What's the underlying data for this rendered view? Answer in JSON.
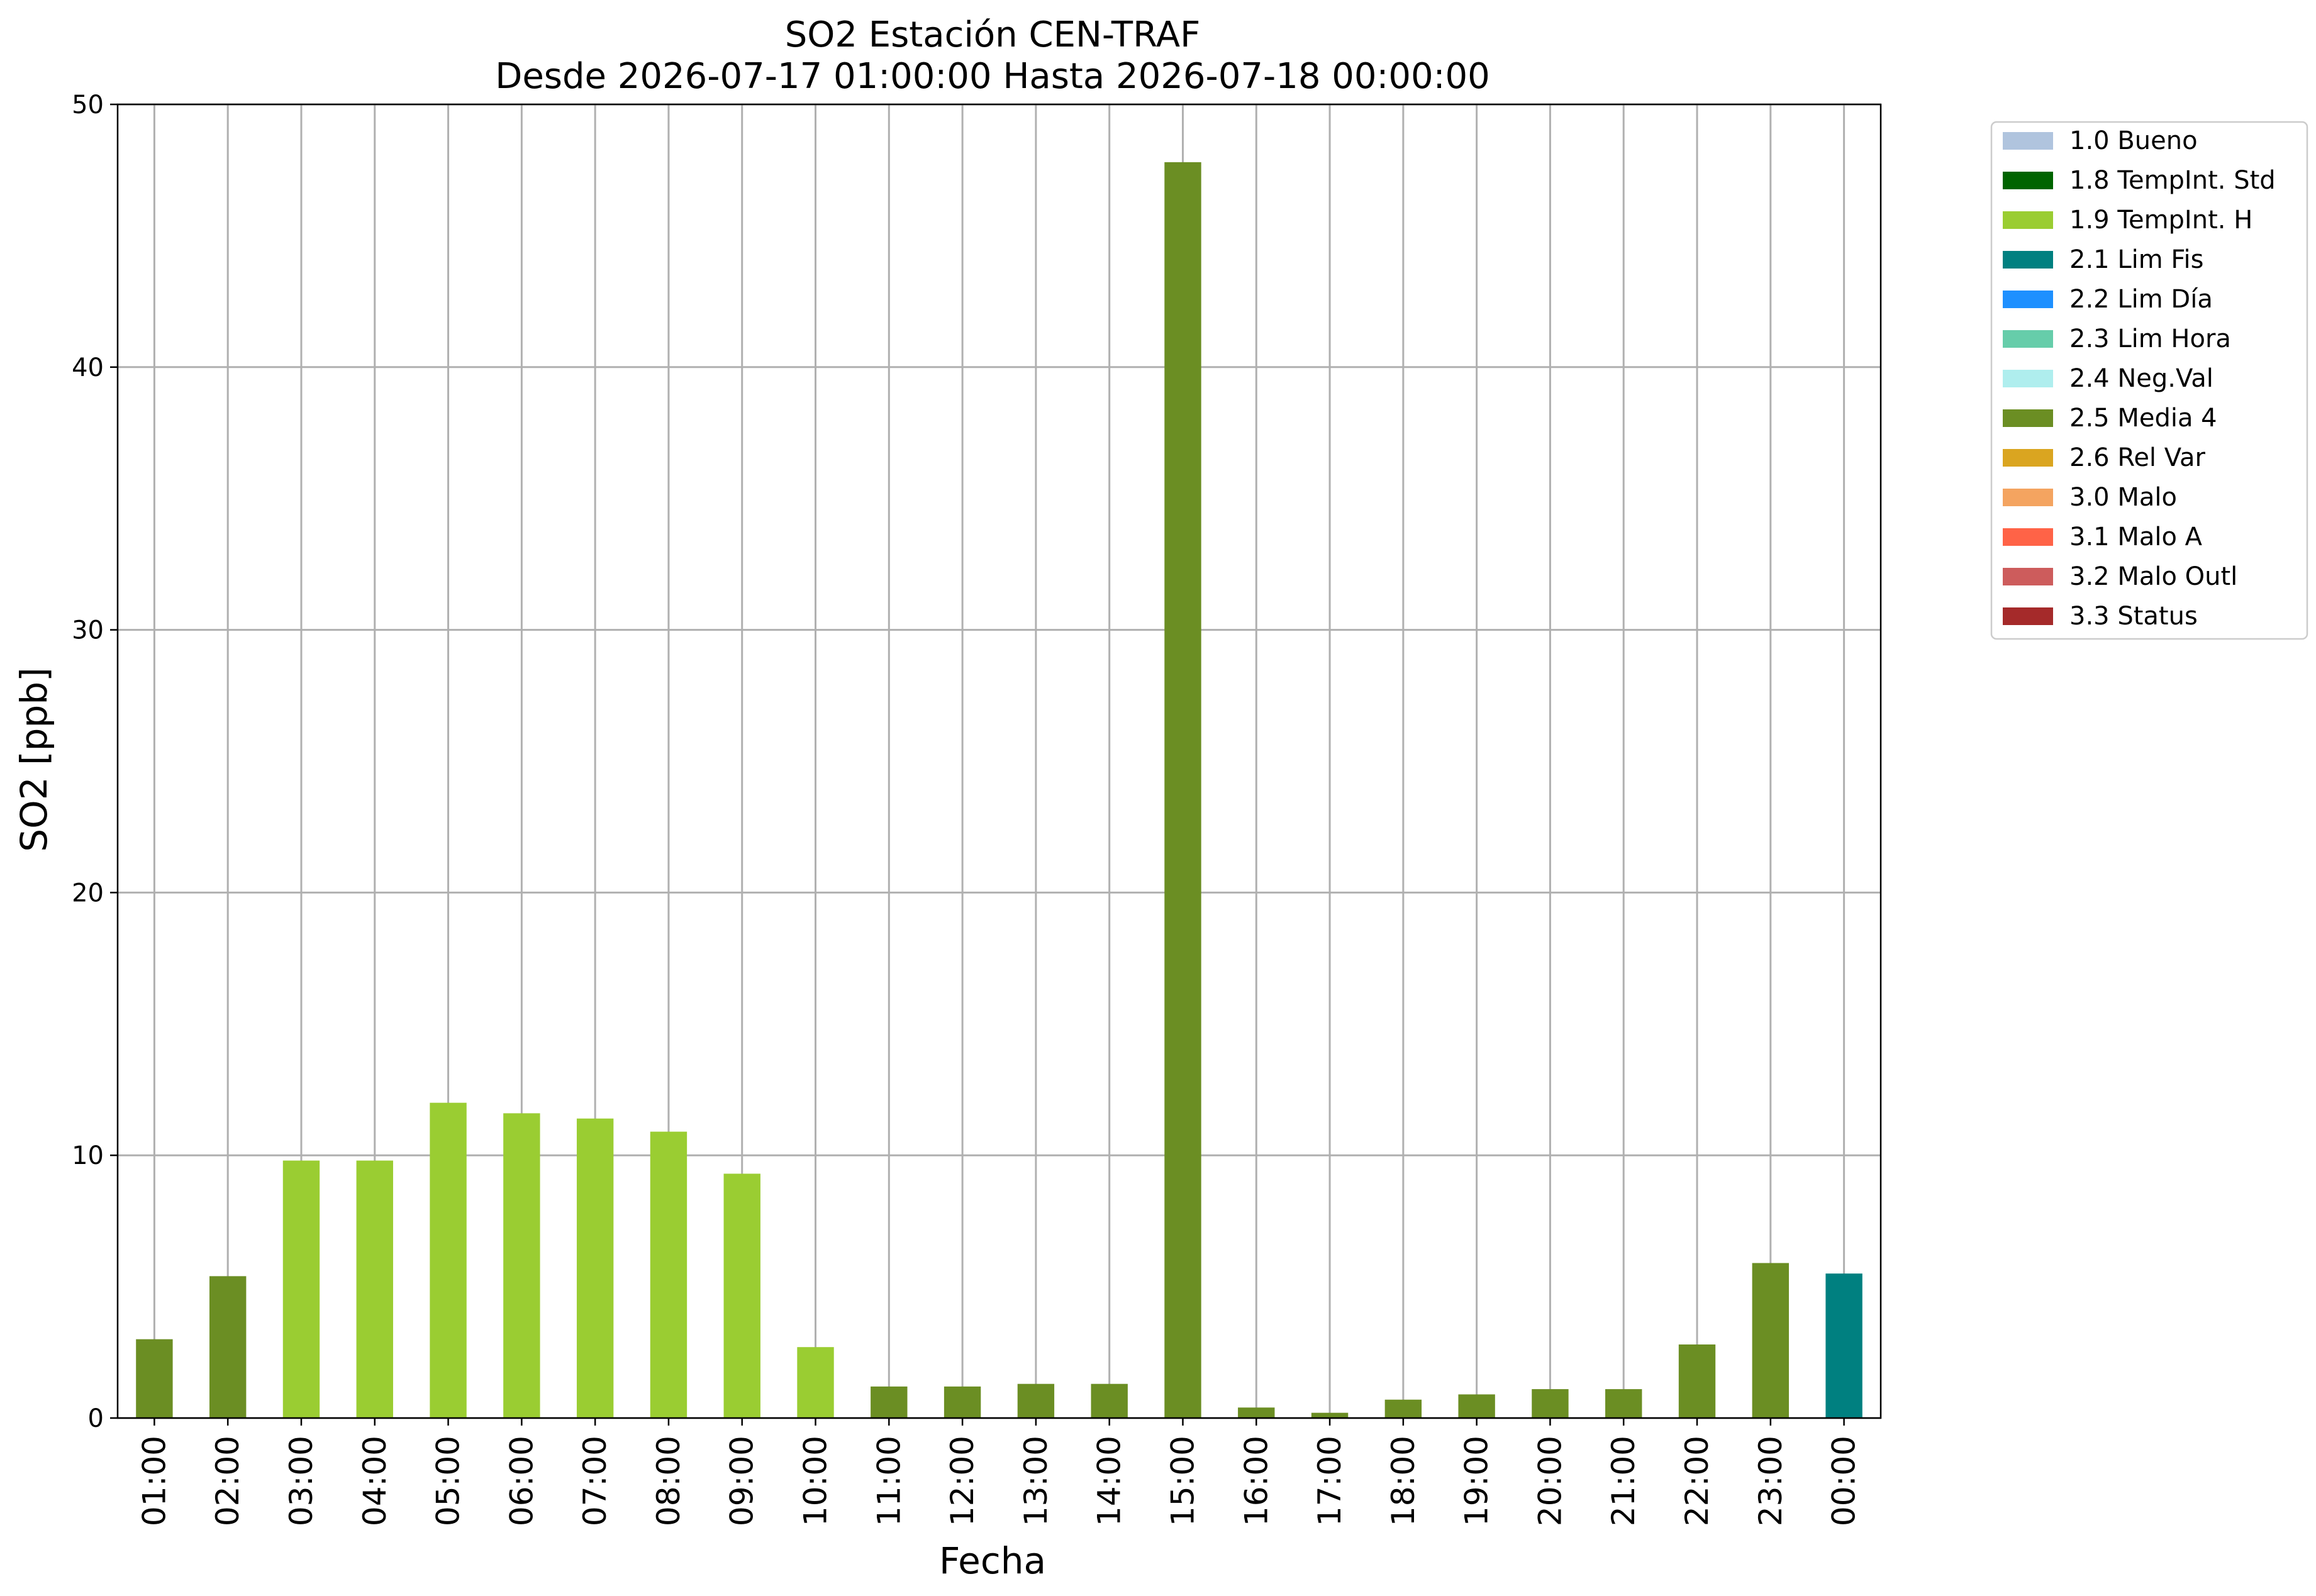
{
  "chart_data": {
    "type": "bar",
    "title": "SO2 Estación CEN-TRAF",
    "subtitle": "Desde 2026-07-17 01:00:00 Hasta 2026-07-18 00:00:00",
    "xlabel": "Fecha",
    "ylabel": "SO2 [ppb]",
    "ylim": [
      0,
      50
    ],
    "yticks": [
      "0",
      "10",
      "20",
      "30",
      "40",
      "50"
    ],
    "grid": true,
    "legend_position": "outside-top-right",
    "categories": [
      "01:00",
      "02:00",
      "03:00",
      "04:00",
      "05:00",
      "06:00",
      "07:00",
      "08:00",
      "09:00",
      "10:00",
      "11:00",
      "12:00",
      "13:00",
      "14:00",
      "15:00",
      "16:00",
      "17:00",
      "18:00",
      "19:00",
      "20:00",
      "21:00",
      "22:00",
      "23:00",
      "00:00"
    ],
    "values": [
      3.0,
      5.4,
      9.8,
      9.8,
      12.0,
      11.6,
      11.4,
      10.9,
      9.3,
      2.7,
      1.2,
      1.2,
      1.3,
      1.3,
      47.8,
      0.4,
      0.2,
      0.7,
      0.9,
      1.1,
      1.1,
      2.8,
      5.9,
      5.5
    ],
    "flags": [
      "2.5 Media 4",
      "2.5 Media 4",
      "1.9 TempInt. H",
      "1.9 TempInt. H",
      "1.9 TempInt. H",
      "1.9 TempInt. H",
      "1.9 TempInt. H",
      "1.9 TempInt. H",
      "1.9 TempInt. H",
      "1.9 TempInt. H",
      "2.5 Media 4",
      "2.5 Media 4",
      "2.5 Media 4",
      "2.5 Media 4",
      "2.5 Media 4",
      "2.5 Media 4",
      "2.5 Media 4",
      "2.5 Media 4",
      "2.5 Media 4",
      "2.5 Media 4",
      "2.5 Media 4",
      "2.5 Media 4",
      "2.5 Media 4",
      "2.1 Lim Fis"
    ],
    "legend": [
      {
        "label": "1.0 Bueno",
        "color": "#b0c4de"
      },
      {
        "label": "1.8 TempInt. Std",
        "color": "#006400"
      },
      {
        "label": "1.9 TempInt. H",
        "color": "#9acd32"
      },
      {
        "label": "2.1 Lim Fis",
        "color": "#008080"
      },
      {
        "label": "2.2 Lim Día",
        "color": "#1e90ff"
      },
      {
        "label": "2.3 Lim Hora",
        "color": "#66cdaa"
      },
      {
        "label": "2.4 Neg.Val",
        "color": "#afeeee"
      },
      {
        "label": "2.5 Media 4",
        "color": "#6b8e23"
      },
      {
        "label": "2.6 Rel Var",
        "color": "#daa520"
      },
      {
        "label": "3.0 Malo",
        "color": "#f4a460"
      },
      {
        "label": "3.1 Malo A",
        "color": "#ff6347"
      },
      {
        "label": "3.2 Malo Outl",
        "color": "#cd5c5c"
      },
      {
        "label": "3.3 Status",
        "color": "#a52a2a"
      }
    ]
  }
}
